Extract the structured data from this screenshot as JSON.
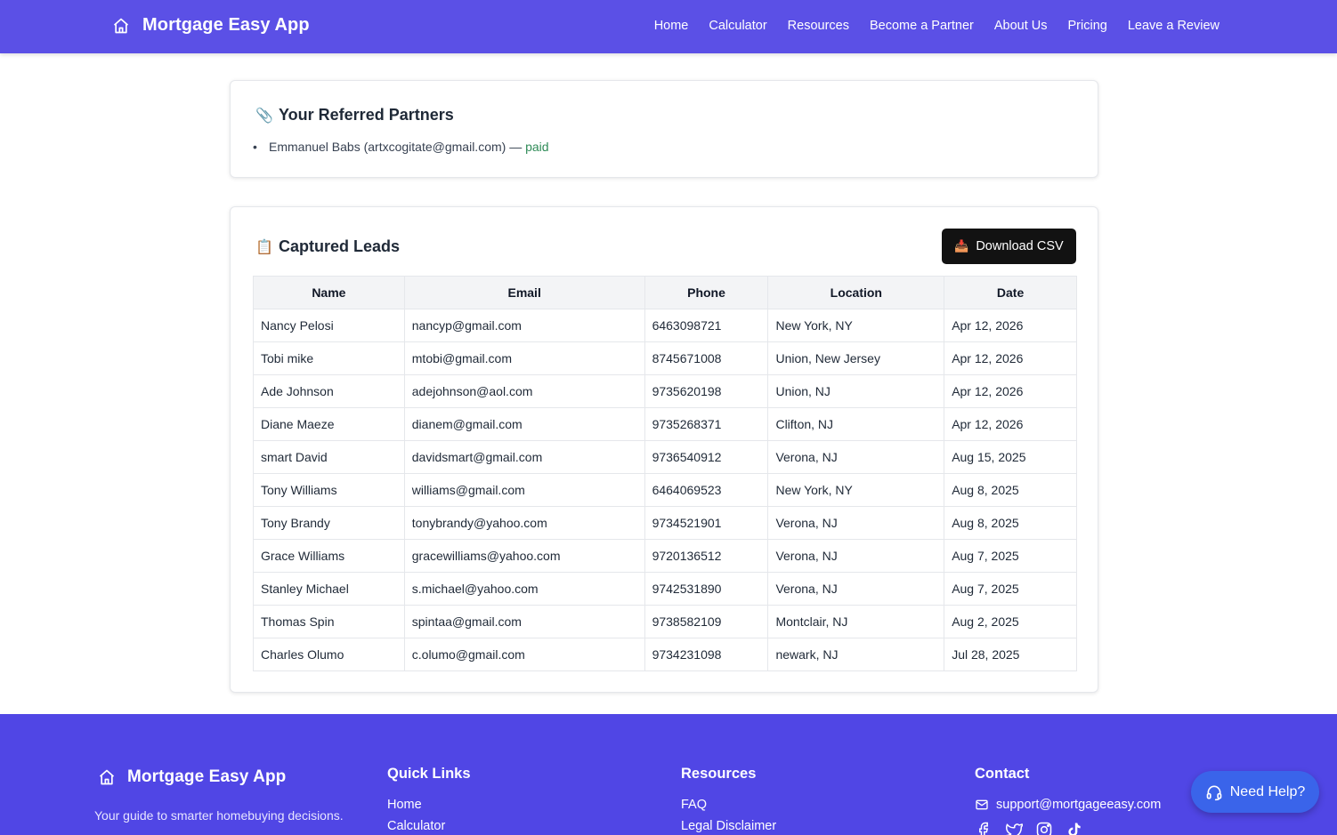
{
  "header": {
    "brand": "Mortgage Easy App",
    "nav": [
      "Home",
      "Calculator",
      "Resources",
      "Become a Partner",
      "About Us",
      "Pricing",
      "Leave a Review"
    ]
  },
  "partners": {
    "icon": "paperclip-icon",
    "title": "Your Referred Partners",
    "items": [
      {
        "text": "Emmanuel Babs (artxcogitate@gmail.com) —",
        "status": "paid"
      }
    ]
  },
  "leads": {
    "icon": "clipboard-icon",
    "title": "Captured Leads",
    "download_icon": "inbox-tray-icon",
    "download_label": "Download CSV",
    "columns": [
      "Name",
      "Email",
      "Phone",
      "Location",
      "Date"
    ],
    "rows": [
      [
        "Nancy Pelosi",
        "nancyp@gmail.com",
        "6463098721",
        "New York, NY",
        "Apr 12, 2026"
      ],
      [
        "Tobi mike",
        "mtobi@gmail.com",
        "8745671008",
        "Union, New Jersey",
        "Apr 12, 2026"
      ],
      [
        "Ade Johnson",
        "adejohnson@aol.com",
        "9735620198",
        "Union, NJ",
        "Apr 12, 2026"
      ],
      [
        "Diane Maeze",
        "dianem@gmail.com",
        "9735268371",
        "Clifton, NJ",
        "Apr 12, 2026"
      ],
      [
        "smart David",
        "davidsmart@gmail.com",
        "9736540912",
        "Verona, NJ",
        "Aug 15, 2025"
      ],
      [
        "Tony Williams",
        "williams@gmail.com",
        "6464069523",
        "New York, NY",
        "Aug 8, 2025"
      ],
      [
        "Tony Brandy",
        "tonybrandy@yahoo.com",
        "9734521901",
        "Verona, NJ",
        "Aug 8, 2025"
      ],
      [
        "Grace Williams",
        "gracewilliams@yahoo.com",
        "9720136512",
        "Verona, NJ",
        "Aug 7, 2025"
      ],
      [
        "Stanley Michael",
        "s.michael@yahoo.com",
        "9742531890",
        "Verona, NJ",
        "Aug 7, 2025"
      ],
      [
        "Thomas Spin",
        "spintaa@gmail.com",
        "9738582109",
        "Montclair, NJ",
        "Aug 2, 2025"
      ],
      [
        "Charles Olumo",
        "c.olumo@gmail.com",
        "9734231098",
        "newark, NJ",
        "Jul 28, 2025"
      ]
    ]
  },
  "footer": {
    "brand": "Mortgage Easy App",
    "tagline": "Your guide to smarter homebuying decisions.",
    "quick_links": {
      "title": "Quick Links",
      "items": [
        "Home",
        "Calculator"
      ]
    },
    "resources": {
      "title": "Resources",
      "items": [
        "FAQ",
        "Legal Disclaimer"
      ]
    },
    "contact": {
      "title": "Contact",
      "email": "support@mortgageeasy.com",
      "socials": [
        "facebook-icon",
        "twitter-icon",
        "instagram-icon",
        "tiktok-icon"
      ]
    }
  },
  "help_button": {
    "label": "Need Help?",
    "icon": "headset-icon"
  },
  "colors": {
    "header_bg": "#5b50e6",
    "footer_bg": "#5046e5",
    "help_bg": "#3a64ea",
    "paid": "#2e8b57",
    "button_dark": "#121212"
  }
}
